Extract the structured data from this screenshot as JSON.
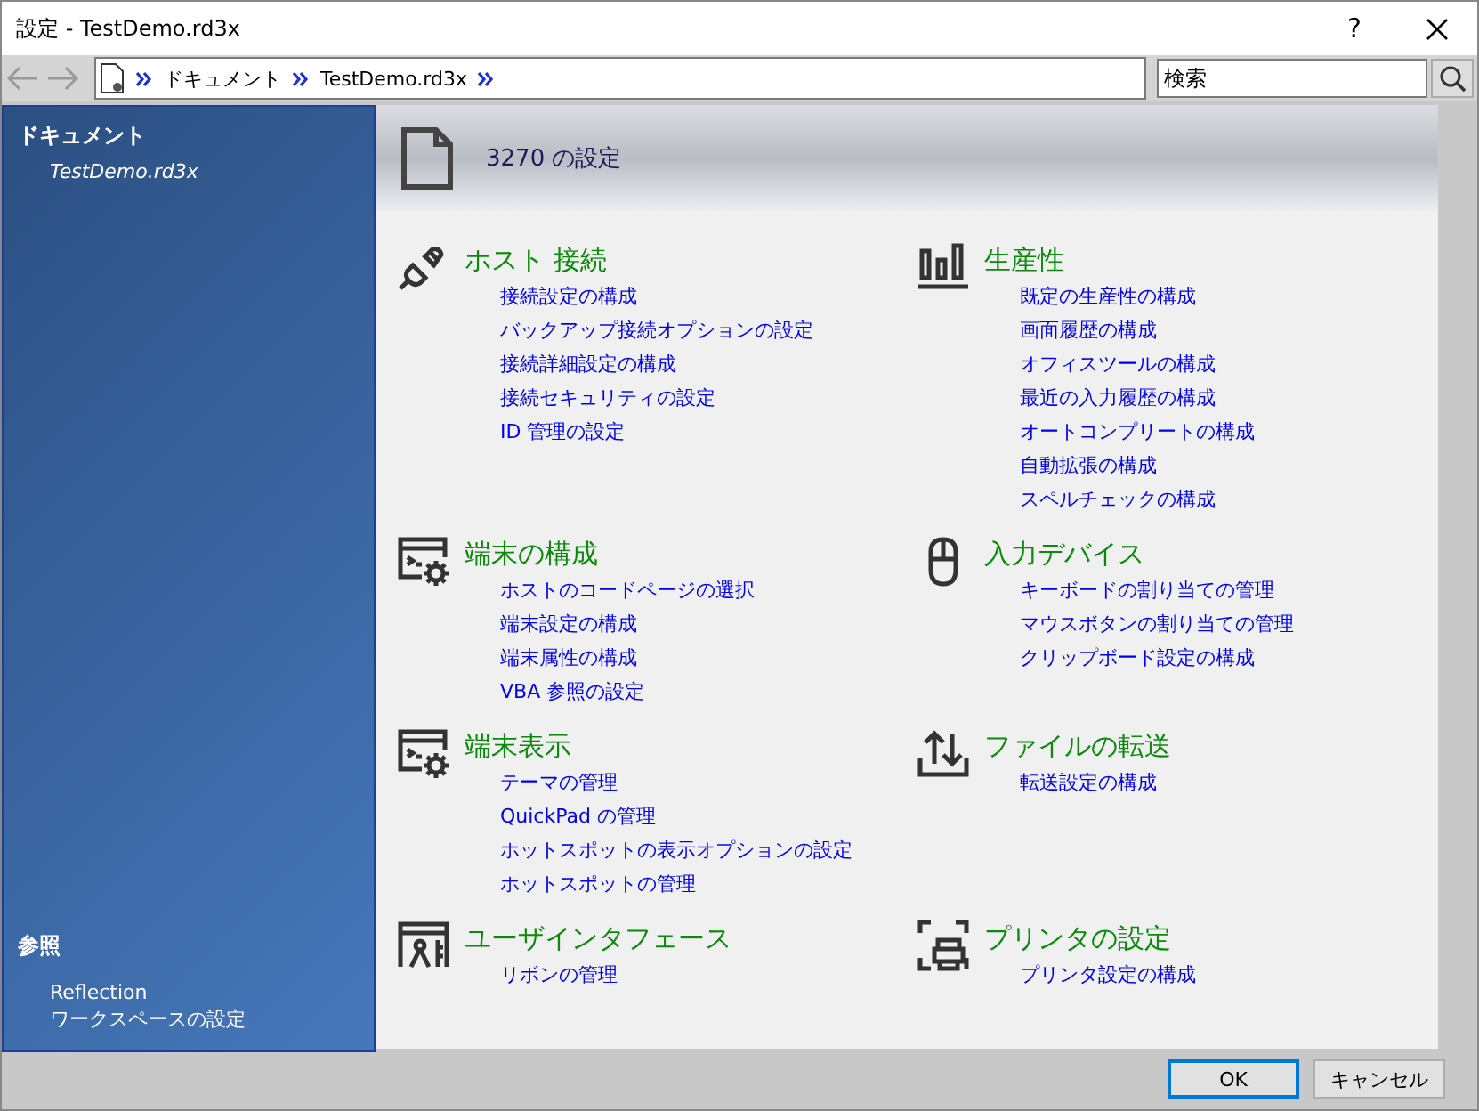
{
  "window": {
    "title": "設定 - TestDemo.rd3x",
    "help": "?"
  },
  "breadcrumb": [
    "ドキュメント",
    "TestDemo.rd3x"
  ],
  "search": {
    "placeholder": "検索"
  },
  "sidebar": {
    "heading": "ドキュメント",
    "items": [
      "TestDemo.rd3x"
    ],
    "refs_heading": "参照",
    "refs": [
      "Reflection",
      "ワークスペースの設定"
    ]
  },
  "header": {
    "title": "3270 の設定"
  },
  "sections": [
    {
      "kind": "plug",
      "title": "ホスト 接続",
      "links": [
        "接続設定の構成",
        "バックアップ接続オプションの設定",
        "接続詳細設定の構成",
        "接続セキュリティの設定",
        "ID 管理の設定"
      ]
    },
    {
      "kind": "chart",
      "title": "生産性",
      "links": [
        "既定の生産性の構成",
        "画面履歴の構成",
        "オフィスツールの構成",
        "最近の入力履歴の構成",
        "オートコンプリートの構成",
        "自動拡張の構成",
        "スペルチェックの構成"
      ]
    },
    {
      "kind": "terminal",
      "title": "端末の構成",
      "links": [
        "ホストのコードページの選択",
        "端末設定の構成",
        "端末属性の構成",
        "VBA 参照の設定"
      ]
    },
    {
      "kind": "mouse",
      "title": "入力デバイス",
      "links": [
        "キーボードの割り当ての管理",
        "マウスボタンの割り当ての管理",
        "クリップボード設定の構成"
      ]
    },
    {
      "kind": "terminal",
      "title": "端末表示",
      "links": [
        "テーマの管理",
        "QuickPad の管理",
        "ホットスポットの表示オプションの設定",
        "ホットスポットの管理"
      ]
    },
    {
      "kind": "transfer",
      "title": "ファイルの転送",
      "links": [
        "転送設定の構成"
      ]
    },
    {
      "kind": "ui",
      "title": "ユーザインタフェース",
      "links": [
        "リボンの管理"
      ]
    },
    {
      "kind": "printer",
      "title": "プリンタの設定",
      "links": [
        "プリンタ設定の構成"
      ]
    }
  ],
  "buttons": [
    {
      "label": "OK",
      "default": true
    },
    {
      "label": "キャンセル",
      "default": false
    }
  ]
}
